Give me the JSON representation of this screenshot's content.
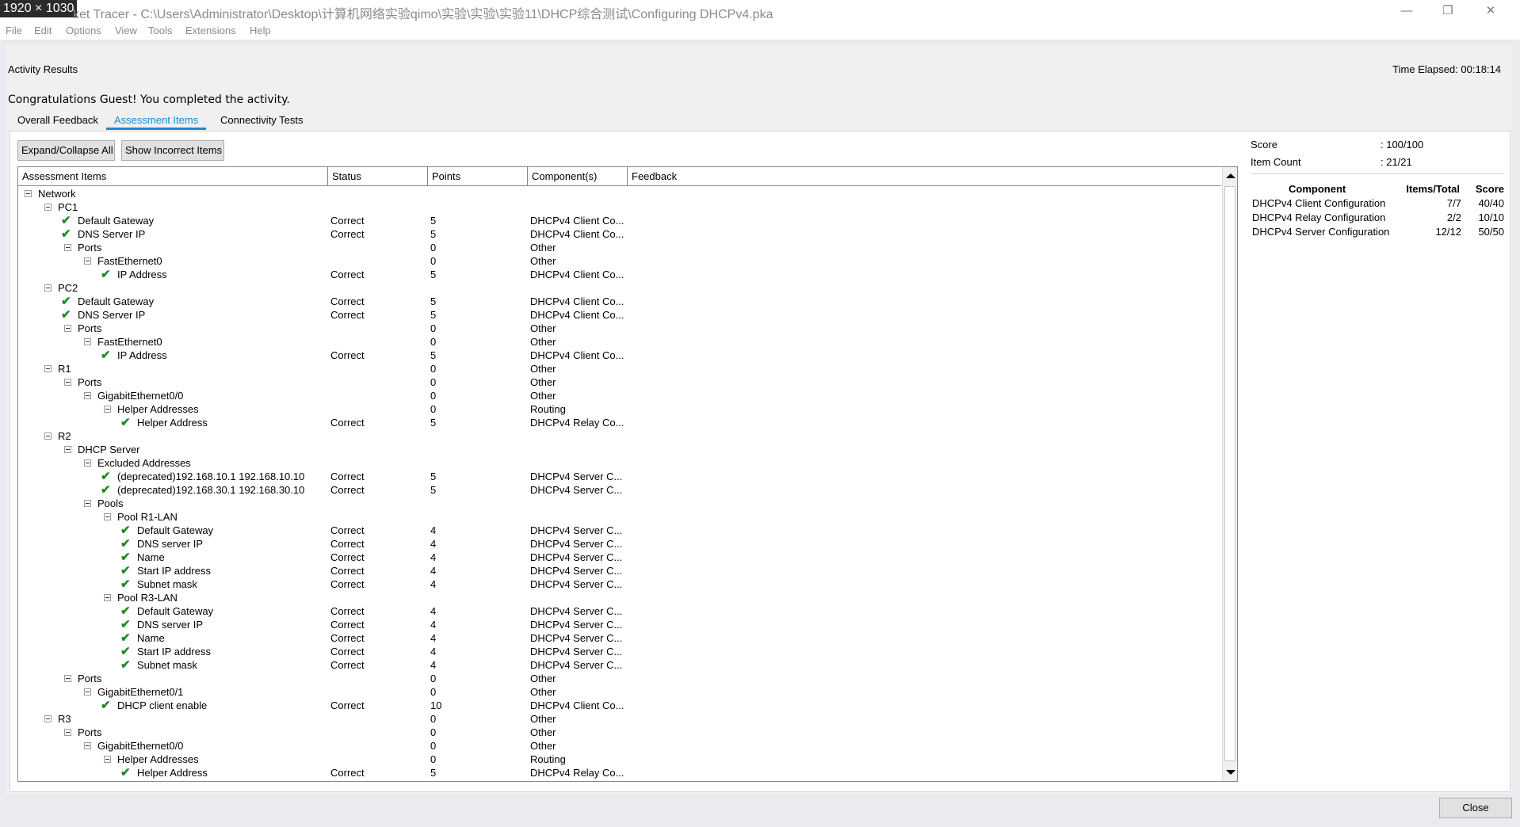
{
  "window": {
    "dim_badge": "1920 × 1030",
    "title": "ket Tracer - C:\\Users\\Administrator\\Desktop\\计算机网络实验qimo\\实验\\实验\\实验11\\DHCP综合测试\\Configuring DHCPv4.pka",
    "minimize": "—",
    "restore": "❐",
    "close": "✕"
  },
  "menu": [
    "File",
    "Edit",
    "Options",
    "View",
    "Tools",
    "Extensions",
    "Help"
  ],
  "header": {
    "activity_title": "Activity Results",
    "time_elapsed": "Time Elapsed: 00:18:14",
    "congrats": "Congratulations Guest! You completed the activity."
  },
  "tabs": [
    {
      "label": "Overall Feedback",
      "active": false
    },
    {
      "label": "Assessment Items",
      "active": true
    },
    {
      "label": "Connectivity Tests",
      "active": false
    }
  ],
  "buttons": {
    "expand_collapse": "Expand/Collapse All",
    "show_incorrect": "Show Incorrect Items",
    "close": "Close"
  },
  "columns": [
    "Assessment Items",
    "Status",
    "Points",
    "Component(s)",
    "Feedback"
  ],
  "rows": [
    {
      "level": 0,
      "type": "node",
      "label": "Network",
      "status": "",
      "points": "",
      "comp": ""
    },
    {
      "level": 1,
      "type": "node",
      "label": "PC1",
      "status": "",
      "points": "",
      "comp": ""
    },
    {
      "level": 2,
      "type": "leaf",
      "label": "Default Gateway",
      "status": "Correct",
      "points": "5",
      "comp": "DHCPv4 Client Co..."
    },
    {
      "level": 2,
      "type": "leaf",
      "label": "DNS Server IP",
      "status": "Correct",
      "points": "5",
      "comp": "DHCPv4 Client Co..."
    },
    {
      "level": 2,
      "type": "node",
      "label": "Ports",
      "status": "",
      "points": "0",
      "comp": "Other"
    },
    {
      "level": 3,
      "type": "node",
      "label": "FastEthernet0",
      "status": "",
      "points": "0",
      "comp": "Other"
    },
    {
      "level": 4,
      "type": "leaf",
      "label": "IP Address",
      "status": "Correct",
      "points": "5",
      "comp": "DHCPv4 Client Co..."
    },
    {
      "level": 1,
      "type": "node",
      "label": "PC2",
      "status": "",
      "points": "",
      "comp": ""
    },
    {
      "level": 2,
      "type": "leaf",
      "label": "Default Gateway",
      "status": "Correct",
      "points": "5",
      "comp": "DHCPv4 Client Co..."
    },
    {
      "level": 2,
      "type": "leaf",
      "label": "DNS Server IP",
      "status": "Correct",
      "points": "5",
      "comp": "DHCPv4 Client Co..."
    },
    {
      "level": 2,
      "type": "node",
      "label": "Ports",
      "status": "",
      "points": "0",
      "comp": "Other"
    },
    {
      "level": 3,
      "type": "node",
      "label": "FastEthernet0",
      "status": "",
      "points": "0",
      "comp": "Other"
    },
    {
      "level": 4,
      "type": "leaf",
      "label": "IP Address",
      "status": "Correct",
      "points": "5",
      "comp": "DHCPv4 Client Co..."
    },
    {
      "level": 1,
      "type": "node",
      "label": "R1",
      "status": "",
      "points": "0",
      "comp": "Other"
    },
    {
      "level": 2,
      "type": "node",
      "label": "Ports",
      "status": "",
      "points": "0",
      "comp": "Other"
    },
    {
      "level": 3,
      "type": "node",
      "label": "GigabitEthernet0/0",
      "status": "",
      "points": "0",
      "comp": "Other"
    },
    {
      "level": 4,
      "type": "node",
      "label": "Helper Addresses",
      "status": "",
      "points": "0",
      "comp": "Routing"
    },
    {
      "level": 5,
      "type": "leaf",
      "label": "Helper Address",
      "status": "Correct",
      "points": "5",
      "comp": "DHCPv4 Relay Co..."
    },
    {
      "level": 1,
      "type": "node",
      "label": "R2",
      "status": "",
      "points": "",
      "comp": ""
    },
    {
      "level": 2,
      "type": "node",
      "label": "DHCP Server",
      "status": "",
      "points": "",
      "comp": ""
    },
    {
      "level": 3,
      "type": "node",
      "label": "Excluded Addresses",
      "status": "",
      "points": "",
      "comp": ""
    },
    {
      "level": 4,
      "type": "leaf",
      "label": "(deprecated)192.168.10.1 192.168.10.10",
      "status": "Correct",
      "points": "5",
      "comp": "DHCPv4 Server C..."
    },
    {
      "level": 4,
      "type": "leaf",
      "label": "(deprecated)192.168.30.1 192.168.30.10",
      "status": "Correct",
      "points": "5",
      "comp": "DHCPv4 Server C..."
    },
    {
      "level": 3,
      "type": "node",
      "label": "Pools",
      "status": "",
      "points": "",
      "comp": ""
    },
    {
      "level": 4,
      "type": "node",
      "label": "Pool R1-LAN",
      "status": "",
      "points": "",
      "comp": ""
    },
    {
      "level": 5,
      "type": "leaf",
      "label": "Default Gateway",
      "status": "Correct",
      "points": "4",
      "comp": "DHCPv4 Server C..."
    },
    {
      "level": 5,
      "type": "leaf",
      "label": "DNS server IP",
      "status": "Correct",
      "points": "4",
      "comp": "DHCPv4 Server C..."
    },
    {
      "level": 5,
      "type": "leaf",
      "label": "Name",
      "status": "Correct",
      "points": "4",
      "comp": "DHCPv4 Server C..."
    },
    {
      "level": 5,
      "type": "leaf",
      "label": "Start IP address",
      "status": "Correct",
      "points": "4",
      "comp": "DHCPv4 Server C..."
    },
    {
      "level": 5,
      "type": "leaf",
      "label": "Subnet mask",
      "status": "Correct",
      "points": "4",
      "comp": "DHCPv4 Server C..."
    },
    {
      "level": 4,
      "type": "node",
      "label": "Pool R3-LAN",
      "status": "",
      "points": "",
      "comp": ""
    },
    {
      "level": 5,
      "type": "leaf",
      "label": "Default Gateway",
      "status": "Correct",
      "points": "4",
      "comp": "DHCPv4 Server C..."
    },
    {
      "level": 5,
      "type": "leaf",
      "label": "DNS server IP",
      "status": "Correct",
      "points": "4",
      "comp": "DHCPv4 Server C..."
    },
    {
      "level": 5,
      "type": "leaf",
      "label": "Name",
      "status": "Correct",
      "points": "4",
      "comp": "DHCPv4 Server C..."
    },
    {
      "level": 5,
      "type": "leaf",
      "label": "Start IP address",
      "status": "Correct",
      "points": "4",
      "comp": "DHCPv4 Server C..."
    },
    {
      "level": 5,
      "type": "leaf",
      "label": "Subnet mask",
      "status": "Correct",
      "points": "4",
      "comp": "DHCPv4 Server C..."
    },
    {
      "level": 2,
      "type": "node",
      "label": "Ports",
      "status": "",
      "points": "0",
      "comp": "Other"
    },
    {
      "level": 3,
      "type": "node",
      "label": "GigabitEthernet0/1",
      "status": "",
      "points": "0",
      "comp": "Other"
    },
    {
      "level": 4,
      "type": "leaf",
      "label": "DHCP client enable",
      "status": "Correct",
      "points": "10",
      "comp": "DHCPv4 Client Co..."
    },
    {
      "level": 1,
      "type": "node",
      "label": "R3",
      "status": "",
      "points": "0",
      "comp": "Other"
    },
    {
      "level": 2,
      "type": "node",
      "label": "Ports",
      "status": "",
      "points": "0",
      "comp": "Other"
    },
    {
      "level": 3,
      "type": "node",
      "label": "GigabitEthernet0/0",
      "status": "",
      "points": "0",
      "comp": "Other"
    },
    {
      "level": 4,
      "type": "node",
      "label": "Helper Addresses",
      "status": "",
      "points": "0",
      "comp": "Routing"
    },
    {
      "level": 5,
      "type": "leaf",
      "label": "Helper Address",
      "status": "Correct",
      "points": "5",
      "comp": "DHCPv4 Relay Co..."
    }
  ],
  "summary": {
    "score_label": "Score",
    "score_value": ": 100/100",
    "count_label": "Item Count",
    "count_value": ": 21/21",
    "table_headers": [
      "Component",
      "Items/Total",
      "Score"
    ],
    "table_rows": [
      [
        "DHCPv4 Client Configuration",
        "7/7",
        "40/40"
      ],
      [
        "DHCPv4 Relay Configuration",
        "2/2",
        "10/10"
      ],
      [
        "DHCPv4 Server Configuration",
        "12/12",
        "50/50"
      ]
    ]
  },
  "colors": {
    "accent": "#1a8ad4",
    "check": "#1e8c1e"
  }
}
